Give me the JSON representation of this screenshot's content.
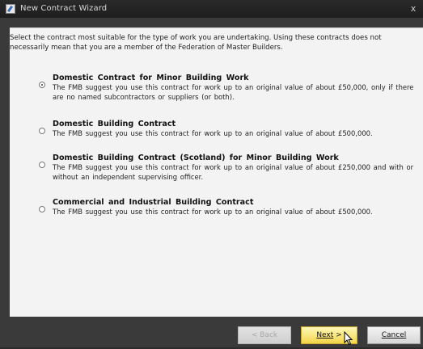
{
  "window": {
    "title": "New Contract Wizard",
    "close_glyph": "x"
  },
  "intro": "Select the contract most suitable for the type of work you are undertaking. Using these contracts does not necessarily mean that you are a member of the Federation of Master Builders.",
  "options": [
    {
      "title": "Domestic Contract for Minor Building Work",
      "description": "The FMB suggest you use this contract for work up to an original value of about £50,000, only if there are no named subcontractors or suppliers (or both).",
      "selected": true
    },
    {
      "title": "Domestic Building Contract",
      "description": "The FMB suggest you use this contract for work up to an original value of about £500,000.",
      "selected": false
    },
    {
      "title": "Domestic Building Contract (Scotland) for Minor Building Work",
      "description": "The FMB suggest you use this contract for work up to an original value of about £250,000 and with or without an independent supervising officer.",
      "selected": false
    },
    {
      "title": "Commercial and Industrial Building Contract",
      "description": "The FMB suggest you use this contract for work up to an original value of about £500,000.",
      "selected": false
    }
  ],
  "buttons": {
    "back": "< Back",
    "next_prefix": "Next",
    "next_suffix": " >",
    "cancel": "Cancel"
  },
  "icons": {
    "app": "wizard-app-icon",
    "cursor": "mouse-pointer-icon"
  }
}
